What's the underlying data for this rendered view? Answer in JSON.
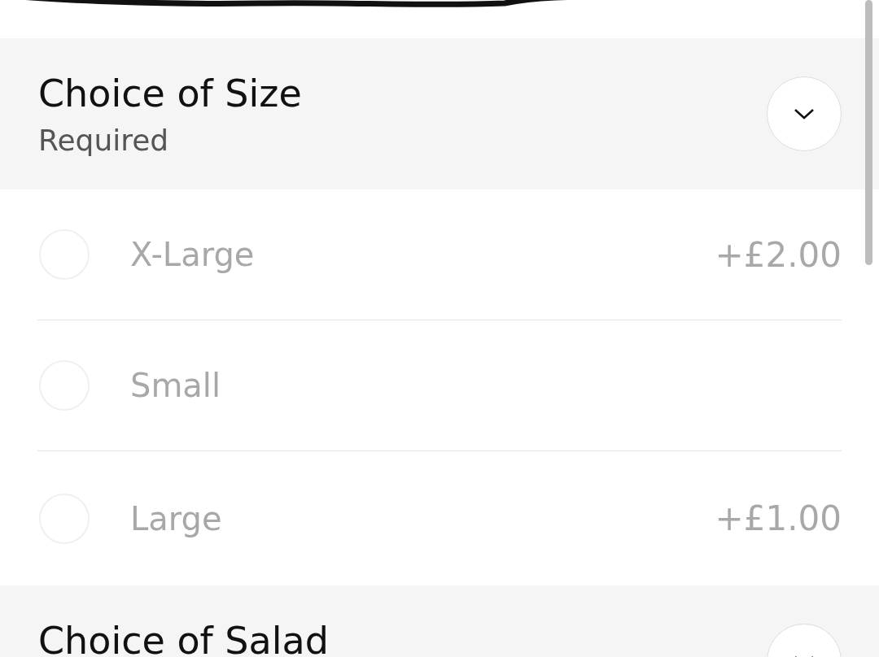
{
  "sections": [
    {
      "title": "Choice of Size",
      "subtitle": "Required",
      "options": [
        {
          "label": "X-Large",
          "price": "+£2.00",
          "selected": false
        },
        {
          "label": "Small",
          "selected": false
        },
        {
          "label": "Large",
          "price": "+£1.00",
          "selected": false
        }
      ]
    },
    {
      "title": "Choice of Salad"
    }
  ]
}
